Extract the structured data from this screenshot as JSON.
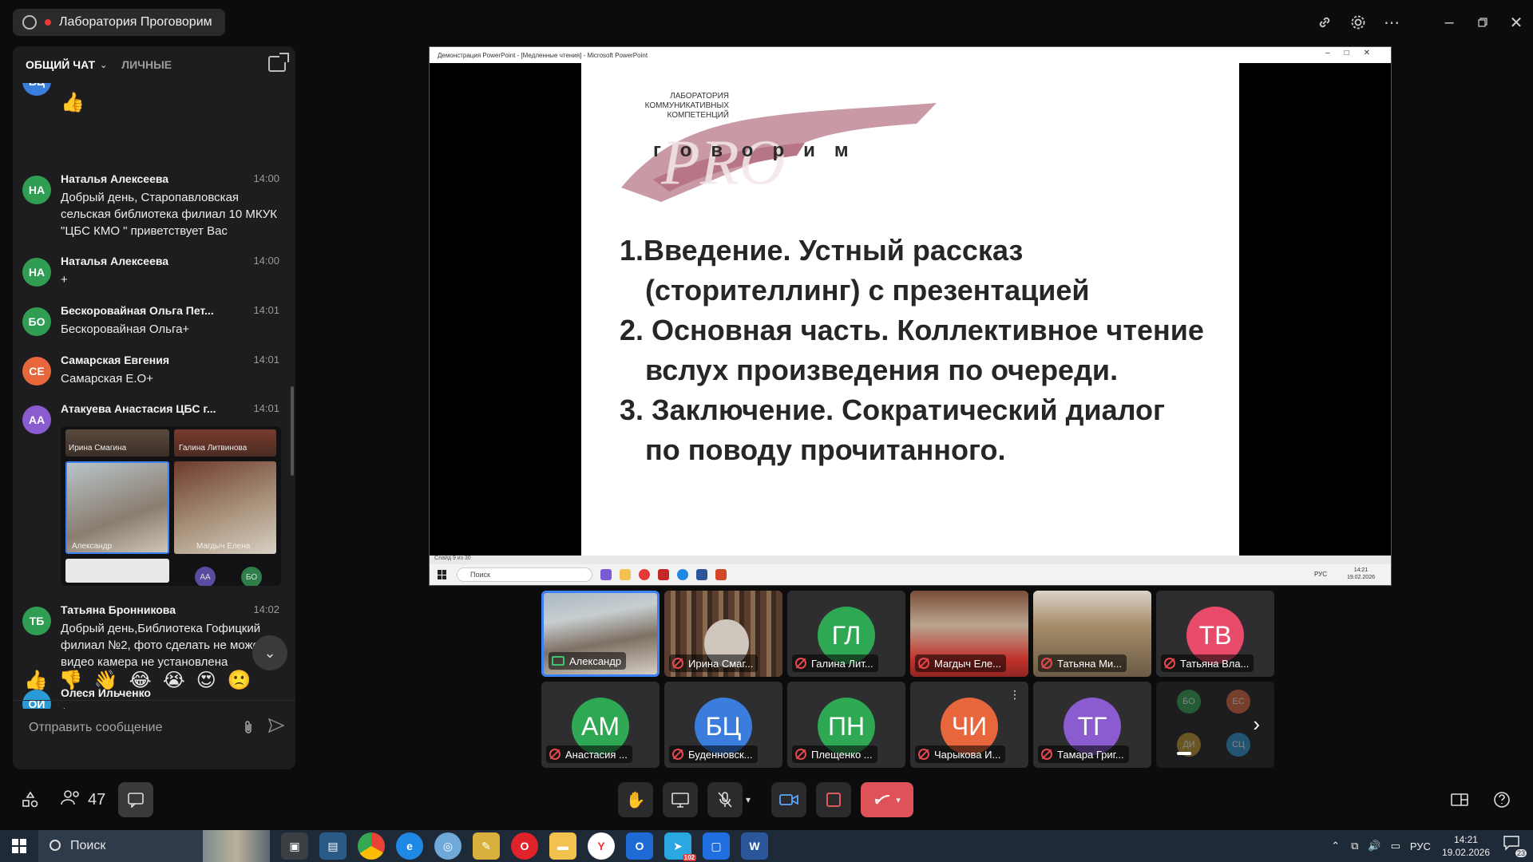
{
  "room": {
    "title": "Лаборатория Проговорим"
  },
  "chat": {
    "tabs": {
      "general": "ОБЩИЙ ЧАТ",
      "personal": "ЛИЧНЫЕ"
    },
    "messages": [
      {
        "initials": "БЦ",
        "name": "",
        "time": "",
        "text": "👍",
        "color": "#3b7ddd"
      },
      {
        "initials": "НА",
        "name": "Наталья Алексеева",
        "time": "14:00",
        "text": "Добрый день, Старопавловская сельская библиотека филиал 10 МКУК \"ЦБС КМО \" приветствует Вас",
        "color": "#2f9e52"
      },
      {
        "initials": "НА",
        "name": "Наталья Алексеева",
        "time": "14:00",
        "text": "+",
        "color": "#2f9e52"
      },
      {
        "initials": "БО",
        "name": "Бескоровайная Ольга Пет...",
        "time": "14:01",
        "text": "Бескоровайная Ольга+",
        "color": "#2f9e52"
      },
      {
        "initials": "СЕ",
        "name": "Самарская Евгения",
        "time": "14:01",
        "text": "Самарская Е.О+",
        "color": "#e8663c"
      },
      {
        "initials": "АА",
        "name": "Атакуева Анастасия ЦБС г...",
        "time": "14:01",
        "text": "",
        "color": "#8a5cd0"
      },
      {
        "initials": "ТБ",
        "name": "Татьяна Бронникова",
        "time": "14:02",
        "text": "Добрый день,Библиотека Гофицкий филиал №2, фото сделать не можем т.к видео камера не установлена",
        "color": "#2f9e52"
      },
      {
        "initials": "ОИ",
        "name": "Олеся Ильченко",
        "time": "",
        "text": "+",
        "color": "#2a9ad6"
      }
    ],
    "photo_labels": {
      "top_left": "Ирина Смагина",
      "top_right": "Галина Литвинова",
      "center_left": "Александр",
      "center_right": "Магдыч Елена"
    },
    "photo_small_avatars": [
      "АА",
      "БО"
    ],
    "emojis": [
      "👍",
      "👎",
      "👋",
      "😂",
      "😭",
      "😍",
      "🙁"
    ],
    "composer_placeholder": "Отправить сообщение"
  },
  "presentation": {
    "window_title": "Демонстрация PowerPoint - [Медленные чтения] - Microsoft PowerPoint",
    "lab_text": [
      "ЛАБОРАТОРИЯ",
      "КОММУНИКАТИВНЫХ",
      "КОМПЕТЕНЦИЙ"
    ],
    "logo_word": "PRO",
    "logo_sub": "говорим",
    "agenda": [
      "1.Введение. Устный рассказ",
      "(сторителлинг) с презентацией",
      "2. Основная часть. Коллективное чтение",
      "вслух произведения  по очереди.",
      "3. Заключение. Сократический диалог",
      "по поводу прочитанного."
    ],
    "status_strip": "Слайд 9 из 30",
    "mini_search": "Поиск",
    "mini_lang": "РУС",
    "mini_time": "14:21",
    "mini_date": "19.02.2026"
  },
  "participants": [
    {
      "initials": "",
      "name": "Александр",
      "muted": false,
      "video": true,
      "color": "#6b7a86"
    },
    {
      "initials": "",
      "name": "Ирина Смаг...",
      "muted": true,
      "video": true,
      "color": "#5b4d40"
    },
    {
      "initials": "ГЛ",
      "name": "Галина Лит...",
      "muted": true,
      "video": false,
      "color": "#2fa853"
    },
    {
      "initials": "",
      "name": "Магдыч Еле...",
      "muted": true,
      "video": true,
      "color": "#6a5446"
    },
    {
      "initials": "",
      "name": "Татьяна Ми...",
      "muted": true,
      "video": true,
      "color": "#8a7a5a"
    },
    {
      "initials": "ТВ",
      "name": "Татьяна Вла...",
      "muted": true,
      "video": false,
      "color": "#e84a6a"
    },
    {
      "initials": "АМ",
      "name": "Анастасия ...",
      "muted": true,
      "video": false,
      "color": "#2fa853"
    },
    {
      "initials": "БЦ",
      "name": "Буденновск...",
      "muted": true,
      "video": false,
      "color": "#3b7ddd"
    },
    {
      "initials": "ПН",
      "name": "Плещенко ...",
      "muted": true,
      "video": false,
      "color": "#2fa853"
    },
    {
      "initials": "ЧИ",
      "name": "Чарыкова И...",
      "muted": true,
      "video": false,
      "color": "#e8663c"
    },
    {
      "initials": "ТГ",
      "name": "Тамара Григ...",
      "muted": true,
      "video": false,
      "color": "#8a5cd0"
    }
  ],
  "more_tile": {
    "avatars": [
      "БО",
      "ЕС",
      "ДИ",
      "СЦ"
    ]
  },
  "controls": {
    "participants_count": "47"
  },
  "taskbar": {
    "search": "Поиск",
    "lang": "РУС",
    "time": "14:21",
    "date": "19.02.2026",
    "badge": "23",
    "app_badge": "102"
  }
}
